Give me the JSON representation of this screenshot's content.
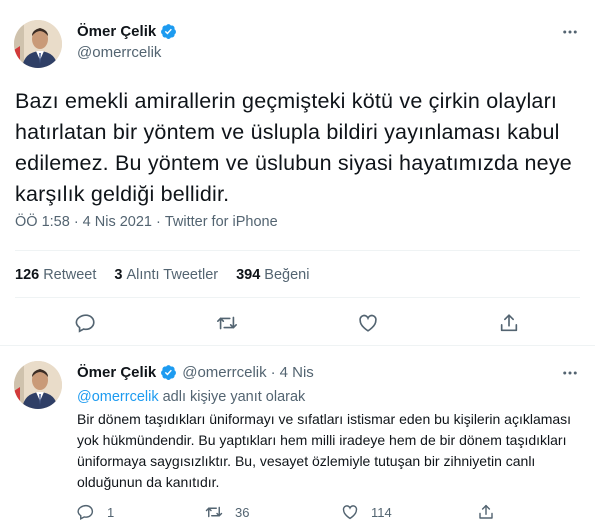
{
  "main_tweet": {
    "display_name": "Ömer Çelik",
    "handle": "@omerrcelik",
    "text": "Bazı emekli amirallerin geçmişteki kötü ve çirkin olayları hatırlatan bir yöntem ve üslupla bildiri yayınlaması kabul edilemez. Bu yöntem ve üslubun siyasi hayatımızda neye karşılık geldiği bellidir.",
    "time": "ÖÖ 1:58",
    "separator": "·",
    "date": "4 Nis 2021",
    "source": "Twitter for iPhone",
    "stats": [
      {
        "count": "126",
        "label": "Retweet"
      },
      {
        "count": "3",
        "label": "Alıntı Tweetler"
      },
      {
        "count": "394",
        "label": "Beğeni"
      }
    ]
  },
  "reply_tweet": {
    "display_name": "Ömer Çelik",
    "handle": "@omerrcelik",
    "separator": "·",
    "date": "4 Nis",
    "replying_mention": "@omerrcelik",
    "replying_suffix": " adlı kişiye yanıt olarak",
    "text": "Bir dönem taşıdıkları üniformayı ve sıfatları istismar eden bu kişilerin açıklaması yok hükmündendir. Bu yaptıkları hem milli iradeye hem de bir dönem taşıdıkları üniformaya saygısızlıktır. Bu, vesayet özlemiyle tutuşan bir zihniyetin canlı olduğunun da kanıtıdır.",
    "counts": {
      "reply": "1",
      "retweet": "36",
      "like": "114"
    }
  },
  "colors": {
    "verified": "#1d9bf0",
    "link": "#1d9bf0",
    "text_primary": "#0f1419",
    "text_secondary": "#536471",
    "divider": "#eff3f4"
  },
  "icons": [
    "verified-badge-icon",
    "more-icon",
    "reply-icon",
    "retweet-icon",
    "like-icon",
    "share-icon"
  ]
}
